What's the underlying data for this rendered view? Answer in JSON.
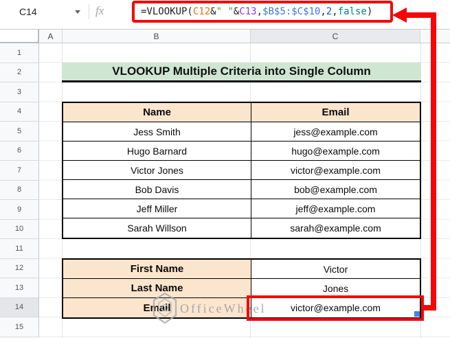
{
  "formula_bar": {
    "cell_reference": "C14",
    "fx_label": "fx",
    "segments": [
      {
        "text": "=VLOOKUP(",
        "color": "#202124"
      },
      {
        "text": "C12",
        "color": "#e8710a"
      },
      {
        "text": "&",
        "color": "#202124"
      },
      {
        "text": "\" \"",
        "color": "#34a853"
      },
      {
        "text": "&",
        "color": "#202124"
      },
      {
        "text": "C13",
        "color": "#9334e6"
      },
      {
        "text": ",",
        "color": "#202124"
      },
      {
        "text": "$B$5:$C$10",
        "color": "#3c78d8"
      },
      {
        "text": ",",
        "color": "#202124"
      },
      {
        "text": "2",
        "color": "#1155cc"
      },
      {
        "text": ",",
        "color": "#202124"
      },
      {
        "text": "false",
        "color": "#00838f"
      },
      {
        "text": ")",
        "color": "#202124"
      }
    ]
  },
  "grid": {
    "column_headers": [
      "A",
      "B",
      "C"
    ],
    "row_headers": [
      "1",
      "2",
      "3",
      "4",
      "5",
      "6",
      "7",
      "8",
      "9",
      "10",
      "11",
      "12",
      "13",
      "14",
      "15"
    ],
    "selected_column": "C",
    "selected_row": "14"
  },
  "sheet": {
    "title": "VLOOKUP Multiple Criteria into Single Column",
    "lookup_table": {
      "headers": [
        "Name",
        "Email"
      ],
      "rows": [
        [
          "Jess Smith",
          "jess@example.com"
        ],
        [
          "Hugo Barnard",
          "hugo@example.com"
        ],
        [
          "Victor Jones",
          "victor@example.com"
        ],
        [
          "Bob Davis",
          "bob@example.com"
        ],
        [
          "Jeff Miller",
          "jeff@example.com"
        ],
        [
          "Sarah Willson",
          "sarah@example.com"
        ]
      ]
    },
    "criteria_table": {
      "rows": [
        {
          "label": "First Name",
          "value": "Victor"
        },
        {
          "label": "Last Name",
          "value": "Jones"
        },
        {
          "label": "Email",
          "value": "victor@example.com"
        }
      ]
    }
  },
  "watermark": {
    "text": "OfficeWheel"
  },
  "colors": {
    "annotation_red": "#f50708",
    "title_green": "#cfe6d3",
    "header_orange": "#fce5cd",
    "selected_header_grey": "#e8eaed",
    "selection_handle_blue": "#4c7fe8"
  }
}
